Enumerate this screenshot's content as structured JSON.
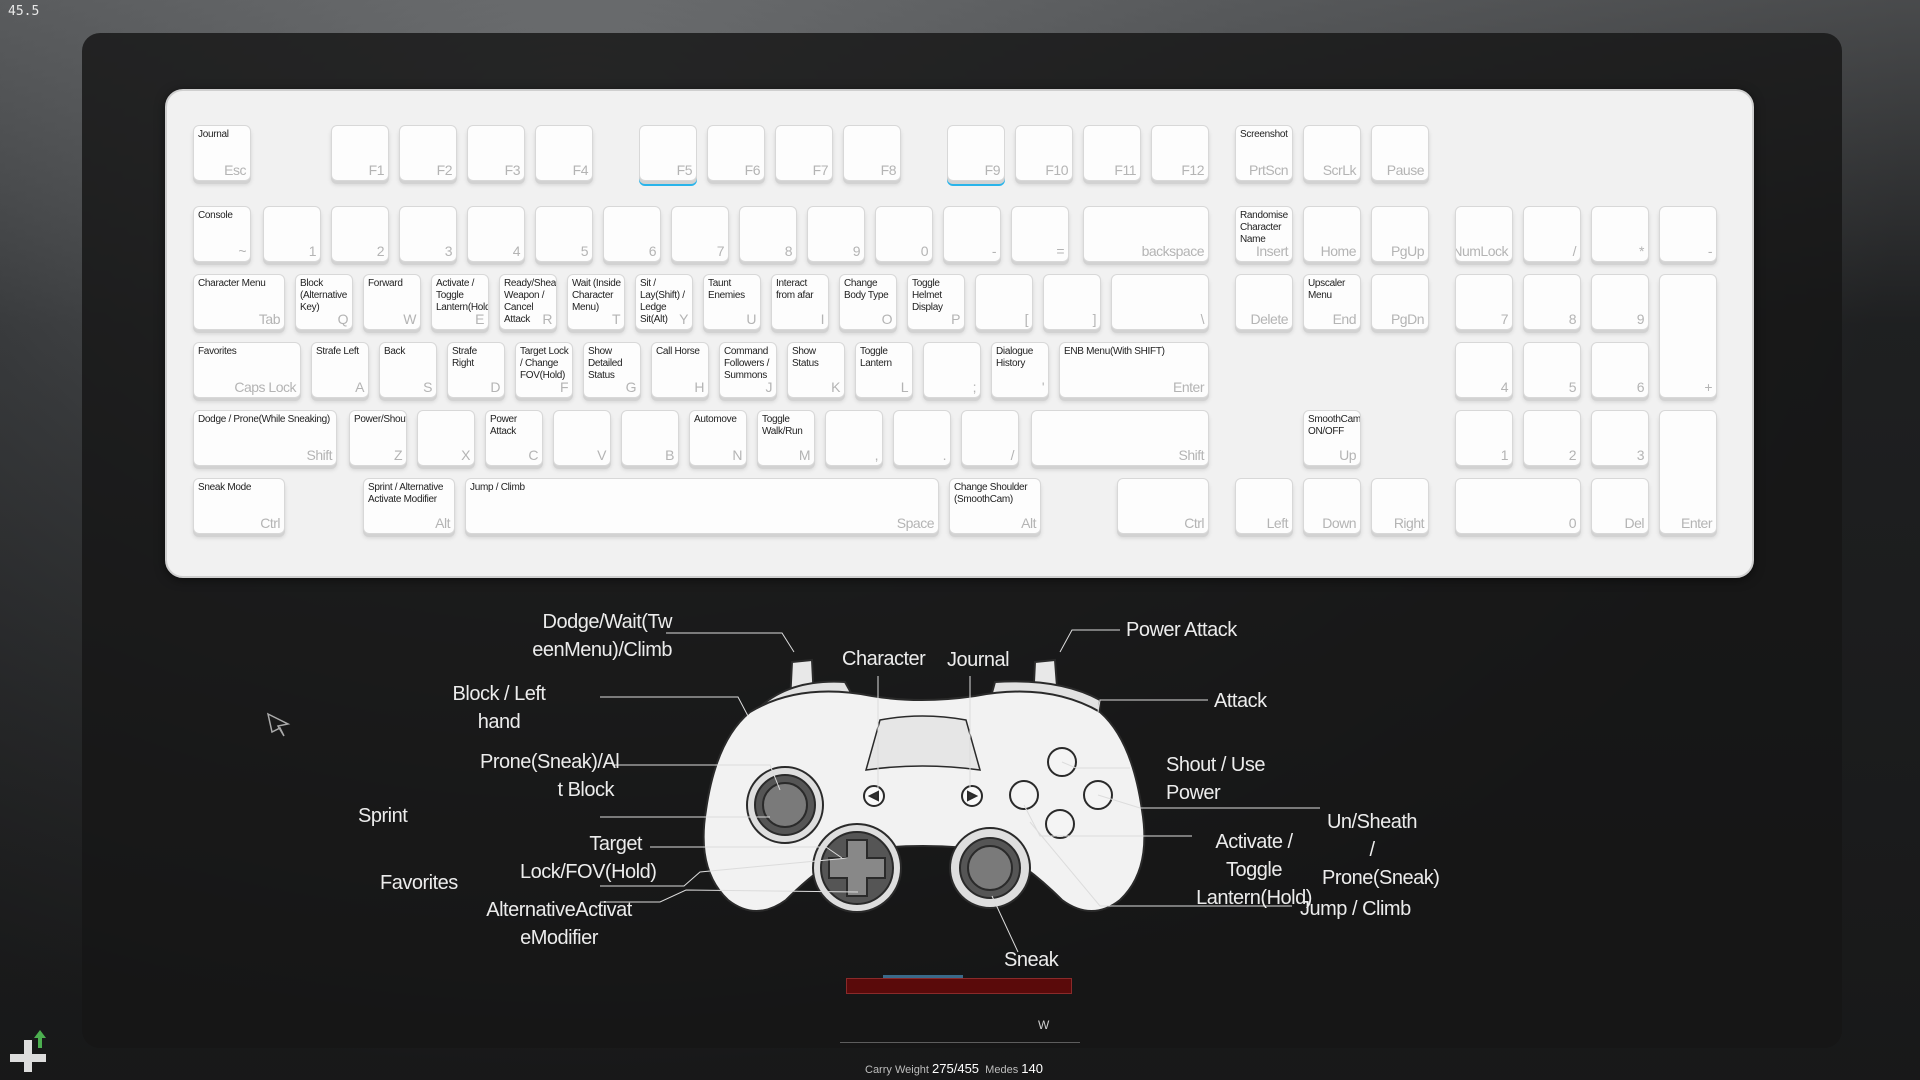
{
  "fps": "45.5",
  "keyboard": {
    "function_row": {
      "esc": {
        "action": "Journal",
        "cap": "Esc"
      },
      "f": [
        "F1",
        "F2",
        "F3",
        "F4",
        "F5",
        "F6",
        "F7",
        "F8",
        "F9",
        "F10",
        "F11",
        "F12"
      ],
      "prtscn": {
        "action": "Screenshot",
        "cap": "PrtScn"
      },
      "scrlk": "ScrLk",
      "pause": "Pause"
    },
    "number_row": {
      "tilde": {
        "action": "Console",
        "cap": "~"
      },
      "digits": [
        "1",
        "2",
        "3",
        "4",
        "5",
        "6",
        "7",
        "8",
        "9",
        "0",
        "-",
        "="
      ],
      "backspace": "backspace",
      "insert": {
        "action": "Randomise Character Name",
        "cap": "Insert"
      },
      "home": "Home",
      "pgup": "PgUp",
      "numlock": "NumLock",
      "slash": "/",
      "star": "*",
      "minus": "-"
    },
    "q_row": {
      "tab": {
        "action": "Character Menu",
        "cap": "Tab"
      },
      "keys": [
        {
          "action": "Block (Alternative Key)",
          "cap": "Q"
        },
        {
          "action": "Forward",
          "cap": "W"
        },
        {
          "action": "Activate / Toggle Lantern(Hold)",
          "cap": "E"
        },
        {
          "action": "Ready/Sheath Weapon / Cancel Attack",
          "cap": "R"
        },
        {
          "action": "Wait (Inside Character Menu)",
          "cap": "T"
        },
        {
          "action": "Sit / Lay(Shift) / Ledge Sit(Alt)",
          "cap": "Y"
        },
        {
          "action": "Taunt Enemies",
          "cap": "U"
        },
        {
          "action": "Interact from afar",
          "cap": "I"
        },
        {
          "action": "Change Body Type",
          "cap": "O"
        },
        {
          "action": "Toggle Helmet Display",
          "cap": "P"
        },
        {
          "action": "",
          "cap": "["
        },
        {
          "action": "",
          "cap": "]"
        }
      ],
      "backslash": "\\",
      "delete": "Delete",
      "end": {
        "action": "Upscaler Menu",
        "cap": "End"
      },
      "pgdn": "PgDn",
      "num7": "7",
      "num8": "8",
      "num9": "9",
      "plus": "+"
    },
    "a_row": {
      "caps": {
        "action": "Favorites",
        "cap": "Caps Lock"
      },
      "keys": [
        {
          "action": "Strafe Left",
          "cap": "A"
        },
        {
          "action": "Back",
          "cap": "S"
        },
        {
          "action": "Strafe Right",
          "cap": "D"
        },
        {
          "action": "Target Lock / Change FOV(Hold)",
          "cap": "F"
        },
        {
          "action": "Show Detailed Status",
          "cap": "G"
        },
        {
          "action": "Call Horse",
          "cap": "H"
        },
        {
          "action": "Command Followers / Summons",
          "cap": "J"
        },
        {
          "action": "Show Status",
          "cap": "K"
        },
        {
          "action": "Toggle Lantern",
          "cap": "L"
        },
        {
          "action": "",
          "cap": ";"
        },
        {
          "action": "Dialogue History",
          "cap": "'"
        }
      ],
      "enter": {
        "action": "ENB Menu(With SHIFT)",
        "cap": "Enter"
      },
      "num4": "4",
      "num5": "5",
      "num6": "6"
    },
    "z_row": {
      "lshift": {
        "action": "Dodge / Prone(While Sneaking)",
        "cap": "Shift"
      },
      "keys": [
        {
          "action": "Power/Shout",
          "cap": "Z"
        },
        {
          "action": "",
          "cap": "X"
        },
        {
          "action": "Power Attack",
          "cap": "C"
        },
        {
          "action": "",
          "cap": "V"
        },
        {
          "action": "",
          "cap": "B"
        },
        {
          "action": "Automove",
          "cap": "N"
        },
        {
          "action": "Toggle Walk/Run",
          "cap": "M"
        },
        {
          "action": "",
          "cap": ","
        },
        {
          "action": "",
          "cap": "."
        },
        {
          "action": "",
          "cap": "/"
        }
      ],
      "rshift": "Shift",
      "up": {
        "action": "SmoothCam ON/OFF",
        "cap": "Up"
      },
      "num1": "1",
      "num2": "2",
      "num3": "3",
      "numenter": "Enter"
    },
    "space_row": {
      "lctrl": {
        "action": "Sneak Mode",
        "cap": "Ctrl"
      },
      "lalt": {
        "action": "Sprint / Alternative Activate Modifier",
        "cap": "Alt"
      },
      "space": {
        "action": "Jump / Climb",
        "cap": "Space"
      },
      "ralt": {
        "action": "Change Shoulder (SmoothCam)",
        "cap": "Alt"
      },
      "rctrl": "Ctrl",
      "left": "Left",
      "down": "Down",
      "right": "Right",
      "num0": "0",
      "del": "Del"
    }
  },
  "controller": {
    "dodge_wait": "Dodge/Wait(Tw eenMenu)/Climb",
    "block": "Block / Left hand",
    "prone_alt_block": "Prone(Sneak)/Al t Block",
    "sprint": "Sprint",
    "target_lock": "Target Lock/FOV(Hold)",
    "favorites": "Favorites",
    "alt_activate": "AlternativeActivat eModifier",
    "character": "Character",
    "journal": "Journal",
    "power_attack": "Power Attack",
    "attack": "Attack",
    "shout": "Shout / Use Power",
    "unsheath": "Un/Sheath / Prone(Sneak)",
    "activate": "Activate / Toggle Lantern(Hold)",
    "jump": "Jump / Climb",
    "sneak": "Sneak"
  },
  "hud": {
    "compass_dir": "W",
    "carry_label": "Carry Weight",
    "carry_value": "275/455",
    "septims_label": "Medes",
    "septims_value": "140"
  }
}
